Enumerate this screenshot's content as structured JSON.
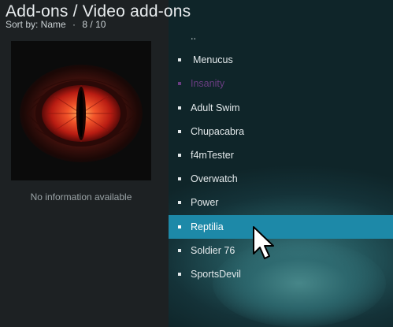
{
  "header": {
    "title": "Add-ons / Video add-ons",
    "sort_label": "Sort by: Name",
    "separator": "·",
    "position": "8 / 10"
  },
  "info_panel": {
    "message": "No information available"
  },
  "list": {
    "items": [
      {
        "label": "..",
        "bullet": false
      },
      {
        "label": "Menucus",
        "bullet": true
      },
      {
        "label": "Insanity",
        "bullet": true
      },
      {
        "label": "Adult Swim",
        "bullet": true
      },
      {
        "label": "Chupacabra",
        "bullet": true
      },
      {
        "label": "f4mTester",
        "bullet": true
      },
      {
        "label": "Overwatch",
        "bullet": true
      },
      {
        "label": "Power",
        "bullet": true
      },
      {
        "label": "Reptilia",
        "bullet": true
      },
      {
        "label": "Soldier 76",
        "bullet": true
      },
      {
        "label": "SportsDevil",
        "bullet": true
      }
    ],
    "selected_index": 8,
    "dimmed_index": 2
  },
  "colors": {
    "selection": "#1d89a8",
    "dimmed_text": "#6a3d82",
    "left_panel": "#1d2123"
  }
}
